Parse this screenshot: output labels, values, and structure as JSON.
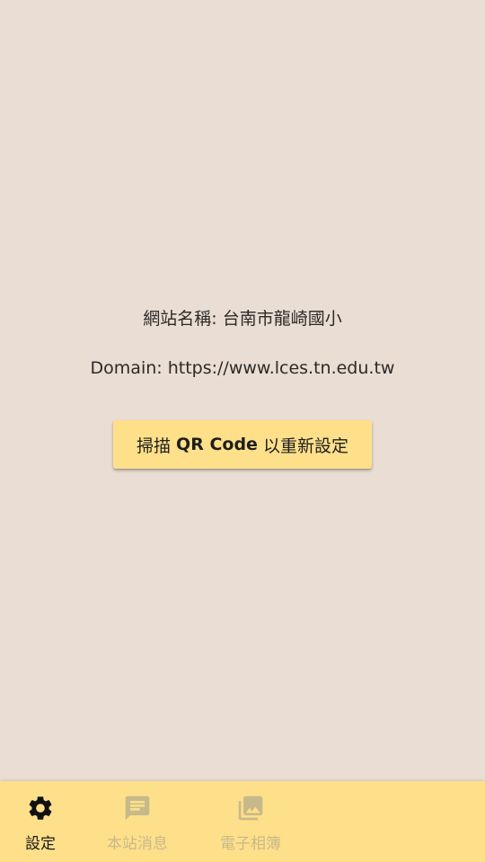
{
  "info": {
    "site_name": "網站名稱: 台南市龍崎國小",
    "domain": "Domain: https://www.lces.tn.edu.tw"
  },
  "scan_button": {
    "prefix": "掃描",
    "bold": "QR Code",
    "suffix": "以重新設定"
  },
  "bottom_nav": {
    "items": [
      {
        "label": "設定",
        "icon": "gear-icon",
        "active": true
      },
      {
        "label": "本站消息",
        "icon": "message-icon",
        "active": false
      },
      {
        "label": "電子相簿",
        "icon": "photo-album-icon",
        "active": false
      }
    ]
  },
  "colors": {
    "background": "#eaddd3",
    "accent": "#ffe08a",
    "nav_active": "#1a1a1a",
    "nav_inactive": "#c7b98a"
  }
}
